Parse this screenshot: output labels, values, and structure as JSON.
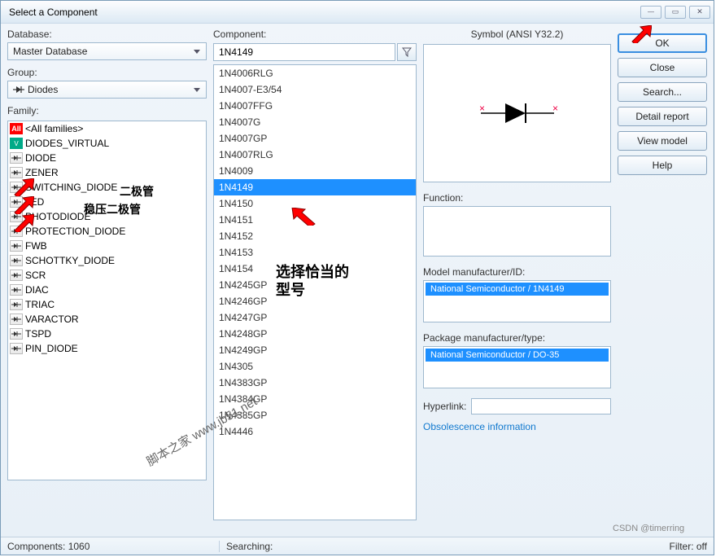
{
  "window": {
    "title": "Select a Component"
  },
  "labels": {
    "database": "Database:",
    "group": "Group:",
    "family": "Family:",
    "component": "Component:",
    "symbol": "Symbol (ANSI Y32.2)",
    "function": "Function:",
    "model_mfr": "Model manufacturer/ID:",
    "pkg_mfr": "Package manufacturer/type:",
    "hyperlink": "Hyperlink:",
    "obsolescence": "Obsolescence information"
  },
  "database": {
    "value": "Master Database"
  },
  "group": {
    "value": "Diodes"
  },
  "families": [
    {
      "name": "<All families>",
      "icon": "all"
    },
    {
      "name": "DIODES_VIRTUAL",
      "icon": "virt"
    },
    {
      "name": "DIODE",
      "icon": "sym"
    },
    {
      "name": "ZENER",
      "icon": "sym"
    },
    {
      "name": "SWITCHING_DIODE",
      "icon": "sym"
    },
    {
      "name": "LED",
      "icon": "sym"
    },
    {
      "name": "PHOTODIODE",
      "icon": "sym"
    },
    {
      "name": "PROTECTION_DIODE",
      "icon": "sym"
    },
    {
      "name": "FWB",
      "icon": "sym"
    },
    {
      "name": "SCHOTTKY_DIODE",
      "icon": "sym"
    },
    {
      "name": "SCR",
      "icon": "sym"
    },
    {
      "name": "DIAC",
      "icon": "sym"
    },
    {
      "name": "TRIAC",
      "icon": "sym"
    },
    {
      "name": "VARACTOR",
      "icon": "sym"
    },
    {
      "name": "TSPD",
      "icon": "sym"
    },
    {
      "name": "PIN_DIODE",
      "icon": "sym"
    }
  ],
  "component_input": "1N4149",
  "components": [
    "1N4006RLG",
    "1N4007-E3/54",
    "1N4007FFG",
    "1N4007G",
    "1N4007GP",
    "1N4007RLG",
    "1N4009",
    "1N4149",
    "1N4150",
    "1N4151",
    "1N4152",
    "1N4153",
    "1N4154",
    "1N4245GP",
    "1N4246GP",
    "1N4247GP",
    "1N4248GP",
    "1N4249GP",
    "1N4305",
    "1N4383GP",
    "1N4384GP",
    "1N4385GP",
    "1N4446"
  ],
  "selected_component": "1N4149",
  "model_id": "National Semiconductor / 1N4149",
  "package_type": "National Semiconductor / DO-35",
  "buttons": {
    "ok": "OK",
    "close": "Close",
    "search": "Search...",
    "detail": "Detail report",
    "view": "View model",
    "help": "Help"
  },
  "status": {
    "components": "Components: 1060",
    "searching": "Searching:",
    "filter": "Filter: off"
  },
  "annotations": {
    "diode_cn": "二极管",
    "zener_cn": "稳压二极管",
    "choose_cn": "选择恰当的型号",
    "watermark1": "脚本之家 www.jb51.net",
    "watermark2": "CSDN @timerring"
  }
}
